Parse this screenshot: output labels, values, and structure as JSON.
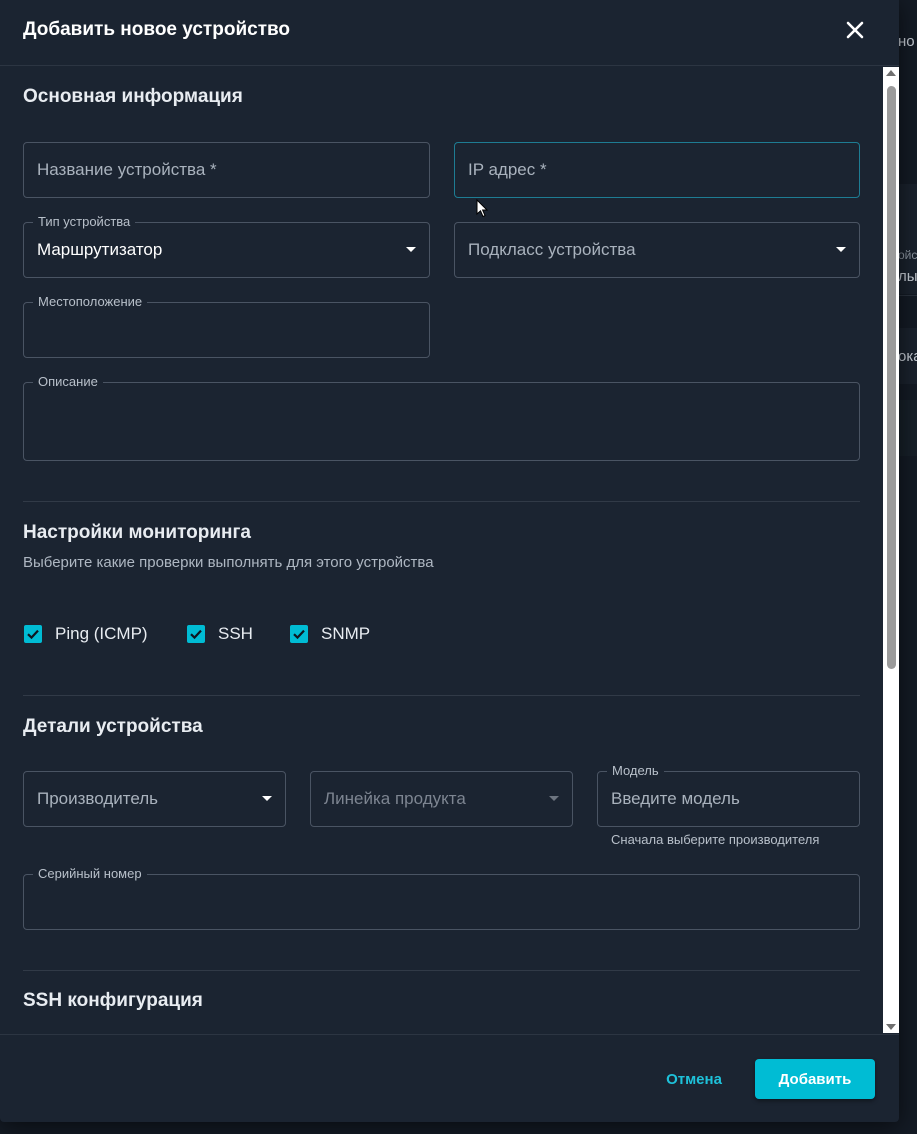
{
  "dialog": {
    "title": "Добавить новое устройство"
  },
  "background": {
    "fragments": [
      "но",
      "ойс",
      "лы",
      "ока"
    ]
  },
  "basic_info": {
    "title": "Основная информация",
    "device_name": {
      "placeholder": "Название устройства *"
    },
    "ip_address": {
      "placeholder": "IP адрес *"
    },
    "device_type": {
      "label": "Тип устройства",
      "value": "Маршрутизатор"
    },
    "device_subclass": {
      "placeholder": "Подкласс устройства"
    },
    "location": {
      "label": "Местоположение",
      "value": ""
    },
    "description": {
      "label": "Описание",
      "value": ""
    }
  },
  "monitoring": {
    "title": "Настройки мониторинга",
    "subtitle": "Выберите какие проверки выполнять для этого устройства",
    "checks": [
      {
        "label": "Ping (ICMP)",
        "checked": true
      },
      {
        "label": "SSH",
        "checked": true
      },
      {
        "label": "SNMP",
        "checked": true
      }
    ]
  },
  "details": {
    "title": "Детали устройства",
    "manufacturer": {
      "placeholder": "Производитель"
    },
    "product_line": {
      "placeholder": "Линейка продукта"
    },
    "model": {
      "label": "Модель",
      "placeholder": "Введите модель",
      "helper": "Сначала выберите производителя"
    },
    "serial": {
      "label": "Серийный номер",
      "value": ""
    }
  },
  "ssh": {
    "title": "SSH конфигурация"
  },
  "footer": {
    "cancel_label": "Отмена",
    "add_label": "Добавить"
  },
  "colors": {
    "accent": "#00bcd4",
    "dialog_bg": "#1b2431",
    "field_border": "#4a5463",
    "focus_border": "#1e7c93"
  }
}
